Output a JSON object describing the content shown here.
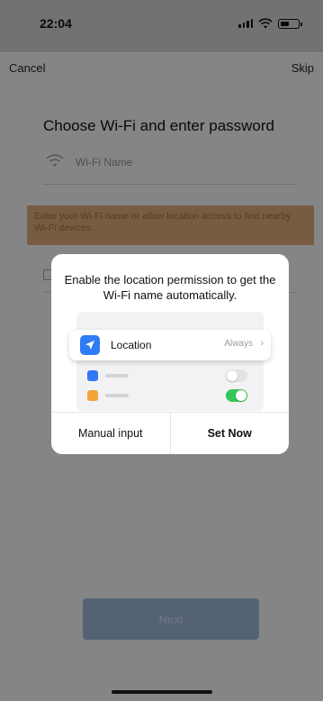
{
  "status_bar": {
    "time": "22:04"
  },
  "nav": {
    "cancel_label": "Cancel",
    "skip_label": "Skip"
  },
  "screen": {
    "title": "Choose Wi-Fi and enter password",
    "wifi_placeholder": "Wi-Fi Name",
    "warning_text": "Enter your Wi-Fi name or allow location access to find nearby Wi-Fi devices.",
    "next_label": "Next"
  },
  "dialog": {
    "title": "Enable the location permission to get the Wi-Fi name automatically.",
    "location_label": "Location",
    "location_value": "Always",
    "manual_label": "Manual input",
    "set_now_label": "Set Now"
  },
  "colors": {
    "accent_blue": "#2e7cf6",
    "toggle_on": "#34c759",
    "warning_bg": "#d9a77a"
  },
  "icons": [
    "wifi-icon",
    "location-arrow-icon",
    "chevron-right-icon",
    "battery-icon",
    "signal-icon"
  ]
}
